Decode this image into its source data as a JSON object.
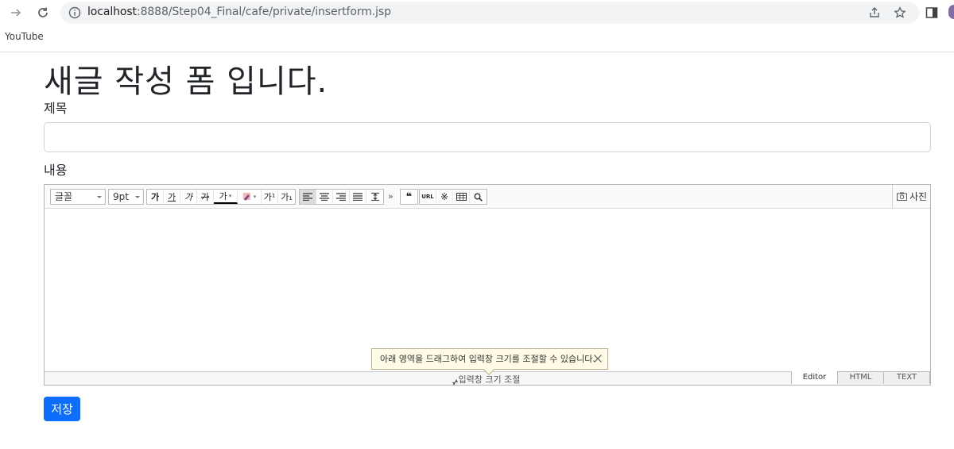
{
  "browser": {
    "url_host": "localhost",
    "url_path": ":8888/Step04_Final/cafe/private/insertform.jsp",
    "bookmarks": [
      "YouTube"
    ]
  },
  "page": {
    "title": "새글 작성 폼 입니다.",
    "subject_label": "제목",
    "subject_value": "",
    "content_label": "내용",
    "save_label": "저장"
  },
  "editor": {
    "font_select": "글꼴",
    "size_select": "9pt",
    "format_buttons": [
      "가",
      "가",
      "가",
      "가",
      "가"
    ],
    "script_buttons": [
      "가¹",
      "가₁"
    ],
    "more": "»",
    "photo_label": "사진",
    "resize_label": "입력창 크기 조절",
    "tooltip": "아래 영역을 드래그하여 입력창 크기를 조절할 수 있습니다.",
    "modes": [
      "Editor",
      "HTML",
      "TEXT"
    ],
    "active_mode": "Editor"
  },
  "colors": {
    "primary": "#0d6efd",
    "tooltip_bg": "#fffbe6"
  }
}
